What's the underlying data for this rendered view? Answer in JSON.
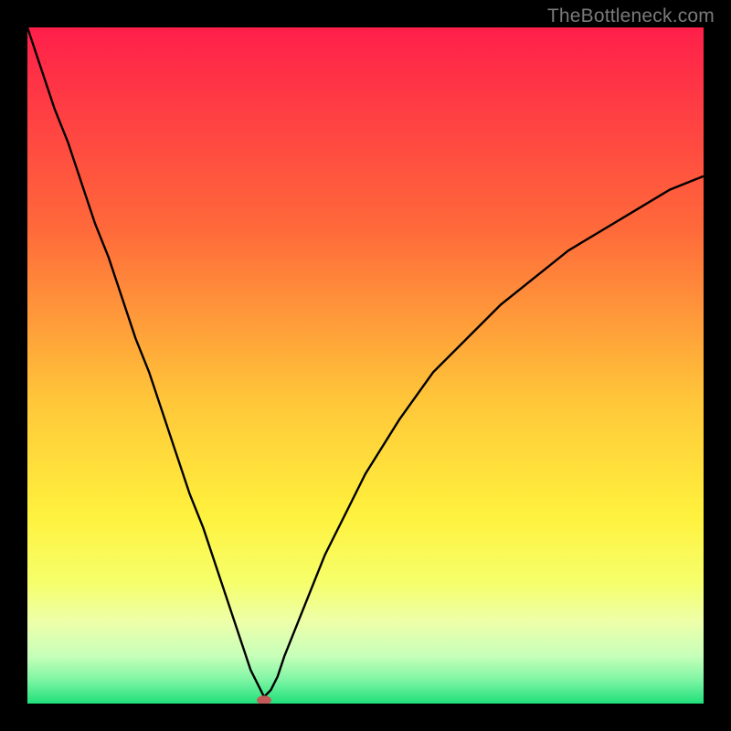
{
  "watermark": "TheBottleneck.com",
  "chart_data": {
    "type": "line",
    "title": "",
    "xlabel": "",
    "ylabel": "",
    "xlim": [
      0,
      100
    ],
    "ylim": [
      0,
      100
    ],
    "grid": false,
    "legend": false,
    "series": [
      {
        "name": "bottleneck-curve",
        "x": [
          0,
          2,
          4,
          6,
          8,
          10,
          12,
          14,
          16,
          18,
          20,
          22,
          24,
          26,
          28,
          30,
          32,
          33,
          34,
          35,
          36,
          37,
          38,
          40,
          42,
          44,
          46,
          48,
          50,
          55,
          60,
          65,
          70,
          75,
          80,
          85,
          90,
          95,
          100
        ],
        "y": [
          100,
          94,
          88,
          83,
          77,
          71,
          66,
          60,
          54,
          49,
          43,
          37,
          31,
          26,
          20,
          14,
          8,
          5,
          3,
          1,
          2,
          4,
          7,
          12,
          17,
          22,
          26,
          30,
          34,
          42,
          49,
          54,
          59,
          63,
          67,
          70,
          73,
          76,
          78
        ]
      }
    ],
    "marker": {
      "name": "optimal-point",
      "x": 35,
      "y": 0.5,
      "color": "#c25a5a"
    },
    "background_gradient": {
      "stops": [
        {
          "offset": 0.0,
          "color": "#ff1f4a"
        },
        {
          "offset": 0.3,
          "color": "#ff6a3a"
        },
        {
          "offset": 0.55,
          "color": "#ffc639"
        },
        {
          "offset": 0.72,
          "color": "#fff13d"
        },
        {
          "offset": 0.82,
          "color": "#f6ff6a"
        },
        {
          "offset": 0.88,
          "color": "#edffaa"
        },
        {
          "offset": 0.93,
          "color": "#c6ffb9"
        },
        {
          "offset": 0.965,
          "color": "#7ef5a4"
        },
        {
          "offset": 1.0,
          "color": "#1fe07a"
        }
      ]
    }
  }
}
